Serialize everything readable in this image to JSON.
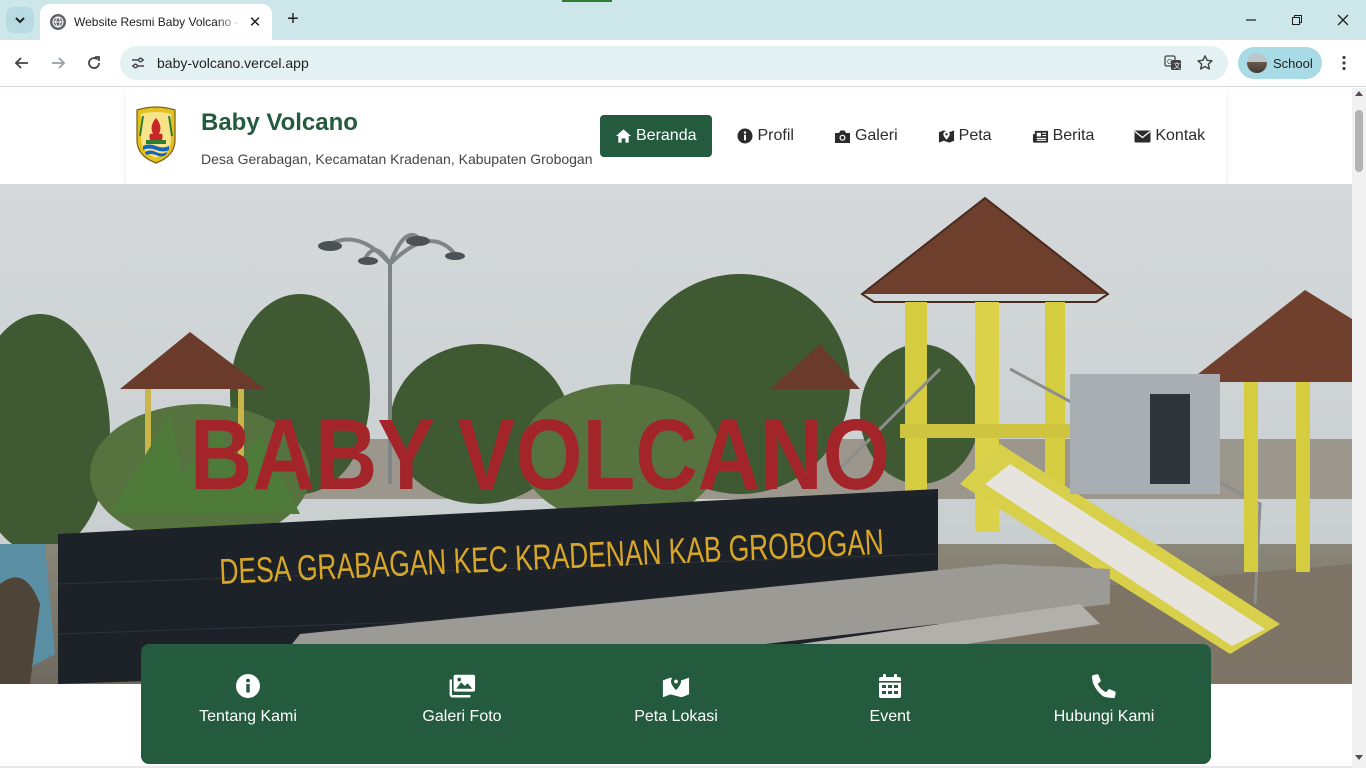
{
  "browser": {
    "tab_title": "Website Resmi Baby Volcano - Desa Gerabagan",
    "url": "baby-volcano.vercel.app",
    "profile_label": "School"
  },
  "header": {
    "title": "Baby Volcano",
    "subtitle": "Desa Gerabagan, Kecamatan Kradenan, Kabupaten Grobogan"
  },
  "nav": {
    "items": [
      {
        "label": "Beranda",
        "icon": "home-icon",
        "active": true
      },
      {
        "label": "Profil",
        "icon": "info-icon",
        "active": false
      },
      {
        "label": "Galeri",
        "icon": "camera-icon",
        "active": false
      },
      {
        "label": "Peta",
        "icon": "map-icon",
        "active": false
      },
      {
        "label": "Berita",
        "icon": "newspaper-icon",
        "active": false
      },
      {
        "label": "Kontak",
        "icon": "envelope-icon",
        "active": false
      }
    ]
  },
  "hero": {
    "sign_text": "BABY VOLCANO",
    "base_text": "DESA GRABAGAN KEC KRADENAN KAB GROBOGAN"
  },
  "quick_links": [
    {
      "label": "Tentang Kami",
      "icon": "info-circle-icon"
    },
    {
      "label": "Galeri Foto",
      "icon": "images-icon"
    },
    {
      "label": "Peta Lokasi",
      "icon": "map-marked-icon"
    },
    {
      "label": "Event",
      "icon": "calendar-icon"
    },
    {
      "label": "Hubungi Kami",
      "icon": "phone-icon"
    }
  ],
  "colors": {
    "brand_green": "#245a3e",
    "chrome_tab_bar": "#cde6e9",
    "sign_red": "#a3252a",
    "sign_gold": "#d8a728"
  }
}
